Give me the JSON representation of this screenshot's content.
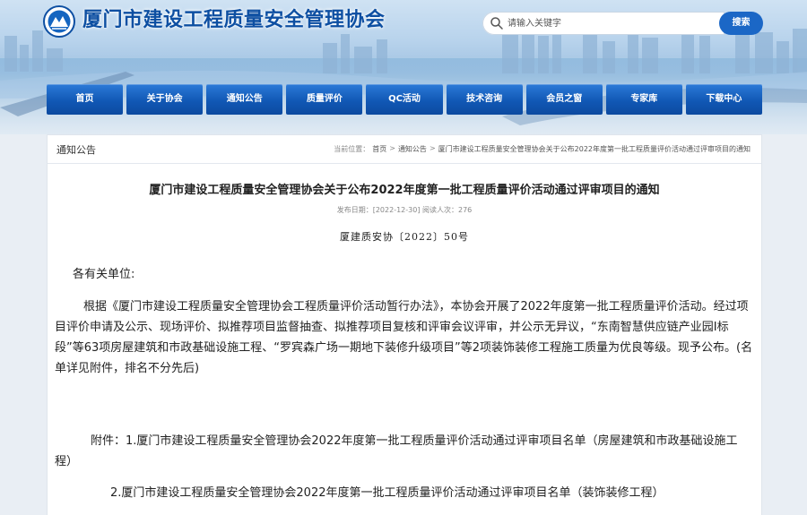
{
  "site": {
    "title": "厦门市建设工程质量安全管理协会",
    "logo_icon": "association-logo-icon"
  },
  "search": {
    "placeholder": "请输入关键字",
    "button_label": "搜索"
  },
  "nav": {
    "items": [
      {
        "label": "首页"
      },
      {
        "label": "关于协会"
      },
      {
        "label": "通知公告"
      },
      {
        "label": "质量评价"
      },
      {
        "label": "QC活动"
      },
      {
        "label": "技术咨询"
      },
      {
        "label": "会员之窗"
      },
      {
        "label": "专家库"
      },
      {
        "label": "下载中心"
      }
    ]
  },
  "panel": {
    "section_title": "通知公告",
    "breadcrumb": {
      "label": "当前位置：",
      "home": "首页",
      "section": "通知公告",
      "current": "厦门市建设工程质量安全管理协会关于公布2022年度第一批工程质量评价活动通过评审项目的通知",
      "separator": ">"
    }
  },
  "article": {
    "title": "厦门市建设工程质量安全管理协会关于公布2022年度第一批工程质量评价活动通过评审项目的通知",
    "meta": "发布日期：[2022-12-30]  阅读人次：276",
    "doc_number": "厦建质安协〔2022〕50号",
    "greeting": "各有关单位:",
    "paragraph": "根据《厦门市建设工程质量安全管理协会工程质量评价活动暂行办法》，本协会开展了2022年度第一批工程质量评价活动。经过项目评价申请及公示、现场评价、拟推荐项目监督抽查、拟推荐项目复核和评审会议评审，并公示无异议，“东南智慧供应链产业园Ⅰ标段”等63项房屋建筑和市政基础设施工程、“罗宾森广场一期地下装修升级项目”等2项装饰装修工程施工质量为优良等级。现予公布。(名单详见附件，排名不分先后)",
    "attachment_1": "附件：1.厦门市建设工程质量安全管理协会2022年度第一批工程质量评价活动通过评审项目名单（房屋建筑和市政基础设施工程）",
    "attachment_2": "2.厦门市建设工程质量安全管理协会2022年度第一批工程质量评价活动通过评审项目名单（装饰装修工程）"
  },
  "colors": {
    "brand_blue": "#0d4fa2",
    "nav_blue": "#1158b5",
    "search_button": "#1b67c6"
  }
}
